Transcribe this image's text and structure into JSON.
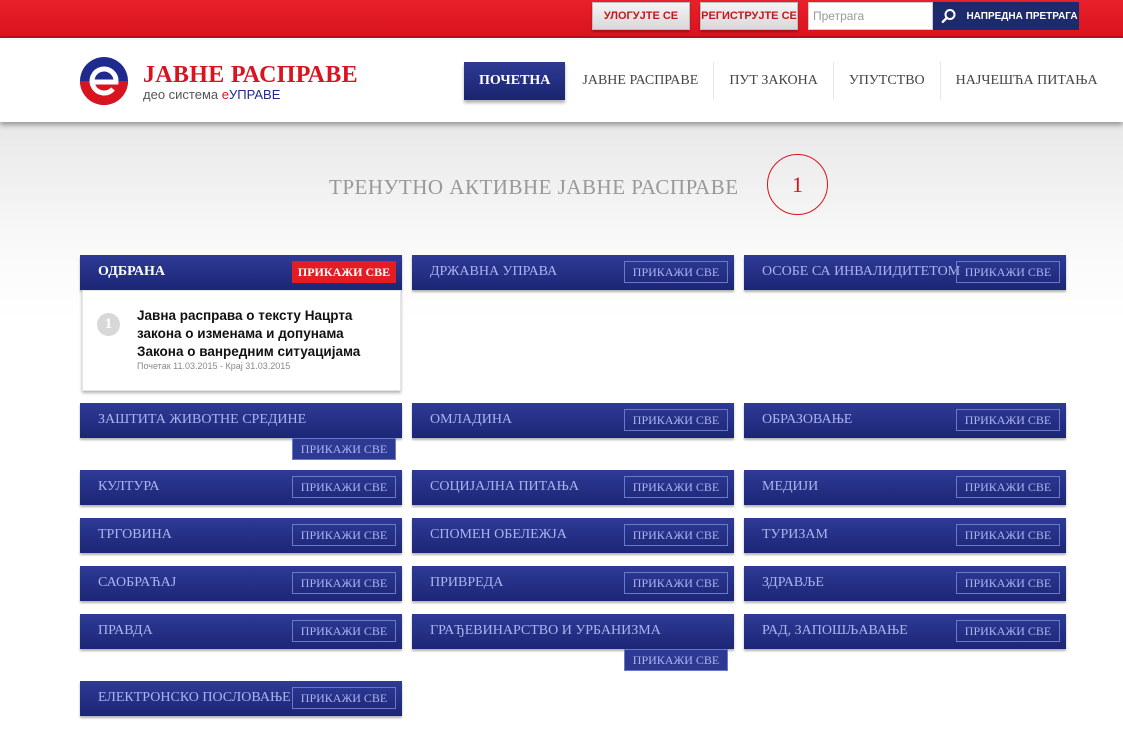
{
  "topbar": {
    "login_label": "УЛОГУЈТЕ СЕ",
    "register_label": "РЕГИСТРУЈТЕ СЕ",
    "search_placeholder": "Претрага",
    "advanced_search_label": "НАПРЕДНА ПРЕТРАГА"
  },
  "header": {
    "logo_title": "ЈАВНЕ РАСПРАВЕ",
    "logo_sub_prefix": "део система ",
    "logo_sub_e": "е",
    "logo_sub_brand": "УПРАВЕ"
  },
  "nav": {
    "items": [
      {
        "label": "ПОЧЕТНА",
        "active": true
      },
      {
        "label": "ЈАВНЕ РАСПРАВЕ"
      },
      {
        "label": "ПУТ ЗАКОНА"
      },
      {
        "label": "УПУТСТВО"
      },
      {
        "label": "НАЈЧЕШЋА ПИТАЊА"
      }
    ]
  },
  "main": {
    "section_title": "ТРЕНУТНО АКТИВНЕ ЈАВНЕ РАСПРАВЕ",
    "active_count": "1",
    "show_all_label": "ПРИКАЖИ СВЕ",
    "categories": [
      "ОДБРАНА",
      "ДРЖАВНА УПРАВА",
      "ОСОБЕ СА ИНВАЛИДИТЕТОМ",
      "ЗАШТИТА ЖИВОТНЕ СРЕДИНЕ",
      "ОМЛАДИНА",
      "ОБРАЗОВАЊЕ",
      "КУЛТУРА",
      "СОЦИЈАЛНА ПИТАЊА",
      "МЕДИЈИ",
      "ТРГОВИНА",
      "СПОМЕН ОБЕЛЕЖЈА",
      "ТУРИЗАМ",
      "САОБРАЋАЈ",
      "ПРИВРЕДА",
      "ЗДРАВЉЕ",
      "ПРАВДА",
      "ГРАЂЕВИНАРСТВО И УРБАНИЗМА",
      "РАД, ЗАПОШЉАВАЊЕ",
      "ЕЛЕКТРОНСКО ПОСЛОВАЊЕ"
    ],
    "debate": {
      "number": "1",
      "title": "Јавна расправа о тексту Нацрта закона о изменама и допунама Закона о ванредним ситуацијама",
      "dates": "Почетак 11.03.2015 - Крај 31.03.2015"
    }
  },
  "colors": {
    "brand_red": "#d9141e",
    "navy": "#1e2a6e"
  }
}
